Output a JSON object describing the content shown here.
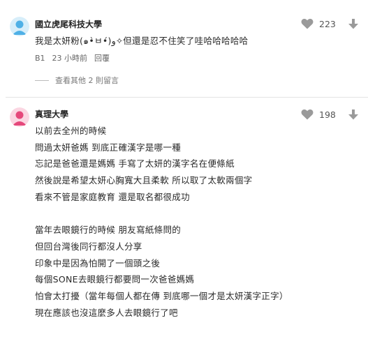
{
  "comments": [
    {
      "author": "國立虎尾科技大學",
      "lines": [
        "我是太妍粉(๑•̀ㅂ•́)و✧但還是忍不住笑了哇哈哈哈哈哈"
      ],
      "floor": "B1",
      "time": "23 小時前",
      "reply_label": "回覆",
      "likes": "223",
      "view_replies": "查看其他 2 則留言",
      "avatar_color": "#4fb0e6",
      "heart_color": "#9a9a9a"
    },
    {
      "author": "真理大學",
      "lines": [
        "以前去全州的時候",
        "問過太妍爸媽 到底正確漢字是哪一種",
        "忘記是爸爸還是媽媽 手寫了太妍的漢字名在便條紙",
        "然後說是希望太妍心胸寬大且柔軟 所以取了太軟兩個字",
        "看來不管是家庭教育 還是取名都很成功",
        "",
        "當年去眼鏡行的時候 朋友寫紙條問的",
        "但回台灣後同行都沒人分享",
        "印象中是因為怕開了一個頭之後",
        "每個SONE去眼鏡行都要問一次爸爸媽媽",
        "怕會太打擾（當年每個人都在傳 到底哪一個才是太妍漢字正字）",
        "現在應該也沒這麼多人去眼鏡行了吧"
      ],
      "likes": "198",
      "avatar_color": "#e5487b",
      "heart_color": "#9a9a9a"
    }
  ]
}
